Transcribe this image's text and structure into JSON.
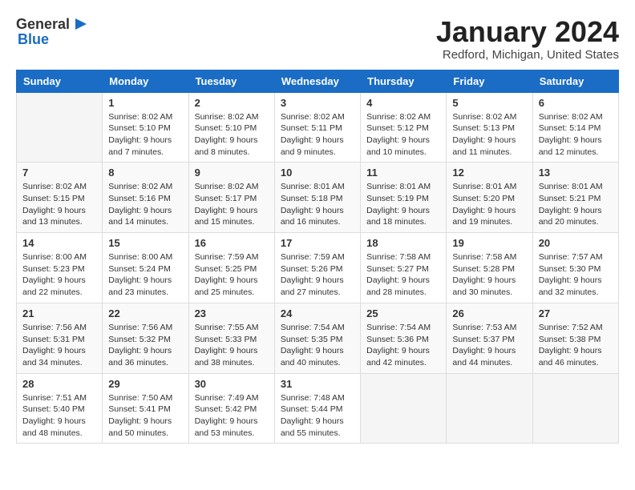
{
  "app": {
    "logo_general": "General",
    "logo_blue": "Blue"
  },
  "header": {
    "month": "January 2024",
    "location": "Redford, Michigan, United States"
  },
  "weekdays": [
    "Sunday",
    "Monday",
    "Tuesday",
    "Wednesday",
    "Thursday",
    "Friday",
    "Saturday"
  ],
  "weeks": [
    [
      {
        "day": "",
        "sunrise": "",
        "sunset": "",
        "daylight": ""
      },
      {
        "day": "1",
        "sunrise": "Sunrise: 8:02 AM",
        "sunset": "Sunset: 5:10 PM",
        "daylight": "Daylight: 9 hours and 7 minutes."
      },
      {
        "day": "2",
        "sunrise": "Sunrise: 8:02 AM",
        "sunset": "Sunset: 5:10 PM",
        "daylight": "Daylight: 9 hours and 8 minutes."
      },
      {
        "day": "3",
        "sunrise": "Sunrise: 8:02 AM",
        "sunset": "Sunset: 5:11 PM",
        "daylight": "Daylight: 9 hours and 9 minutes."
      },
      {
        "day": "4",
        "sunrise": "Sunrise: 8:02 AM",
        "sunset": "Sunset: 5:12 PM",
        "daylight": "Daylight: 9 hours and 10 minutes."
      },
      {
        "day": "5",
        "sunrise": "Sunrise: 8:02 AM",
        "sunset": "Sunset: 5:13 PM",
        "daylight": "Daylight: 9 hours and 11 minutes."
      },
      {
        "day": "6",
        "sunrise": "Sunrise: 8:02 AM",
        "sunset": "Sunset: 5:14 PM",
        "daylight": "Daylight: 9 hours and 12 minutes."
      }
    ],
    [
      {
        "day": "7",
        "sunrise": "Sunrise: 8:02 AM",
        "sunset": "Sunset: 5:15 PM",
        "daylight": "Daylight: 9 hours and 13 minutes."
      },
      {
        "day": "8",
        "sunrise": "Sunrise: 8:02 AM",
        "sunset": "Sunset: 5:16 PM",
        "daylight": "Daylight: 9 hours and 14 minutes."
      },
      {
        "day": "9",
        "sunrise": "Sunrise: 8:02 AM",
        "sunset": "Sunset: 5:17 PM",
        "daylight": "Daylight: 9 hours and 15 minutes."
      },
      {
        "day": "10",
        "sunrise": "Sunrise: 8:01 AM",
        "sunset": "Sunset: 5:18 PM",
        "daylight": "Daylight: 9 hours and 16 minutes."
      },
      {
        "day": "11",
        "sunrise": "Sunrise: 8:01 AM",
        "sunset": "Sunset: 5:19 PM",
        "daylight": "Daylight: 9 hours and 18 minutes."
      },
      {
        "day": "12",
        "sunrise": "Sunrise: 8:01 AM",
        "sunset": "Sunset: 5:20 PM",
        "daylight": "Daylight: 9 hours and 19 minutes."
      },
      {
        "day": "13",
        "sunrise": "Sunrise: 8:01 AM",
        "sunset": "Sunset: 5:21 PM",
        "daylight": "Daylight: 9 hours and 20 minutes."
      }
    ],
    [
      {
        "day": "14",
        "sunrise": "Sunrise: 8:00 AM",
        "sunset": "Sunset: 5:23 PM",
        "daylight": "Daylight: 9 hours and 22 minutes."
      },
      {
        "day": "15",
        "sunrise": "Sunrise: 8:00 AM",
        "sunset": "Sunset: 5:24 PM",
        "daylight": "Daylight: 9 hours and 23 minutes."
      },
      {
        "day": "16",
        "sunrise": "Sunrise: 7:59 AM",
        "sunset": "Sunset: 5:25 PM",
        "daylight": "Daylight: 9 hours and 25 minutes."
      },
      {
        "day": "17",
        "sunrise": "Sunrise: 7:59 AM",
        "sunset": "Sunset: 5:26 PM",
        "daylight": "Daylight: 9 hours and 27 minutes."
      },
      {
        "day": "18",
        "sunrise": "Sunrise: 7:58 AM",
        "sunset": "Sunset: 5:27 PM",
        "daylight": "Daylight: 9 hours and 28 minutes."
      },
      {
        "day": "19",
        "sunrise": "Sunrise: 7:58 AM",
        "sunset": "Sunset: 5:28 PM",
        "daylight": "Daylight: 9 hours and 30 minutes."
      },
      {
        "day": "20",
        "sunrise": "Sunrise: 7:57 AM",
        "sunset": "Sunset: 5:30 PM",
        "daylight": "Daylight: 9 hours and 32 minutes."
      }
    ],
    [
      {
        "day": "21",
        "sunrise": "Sunrise: 7:56 AM",
        "sunset": "Sunset: 5:31 PM",
        "daylight": "Daylight: 9 hours and 34 minutes."
      },
      {
        "day": "22",
        "sunrise": "Sunrise: 7:56 AM",
        "sunset": "Sunset: 5:32 PM",
        "daylight": "Daylight: 9 hours and 36 minutes."
      },
      {
        "day": "23",
        "sunrise": "Sunrise: 7:55 AM",
        "sunset": "Sunset: 5:33 PM",
        "daylight": "Daylight: 9 hours and 38 minutes."
      },
      {
        "day": "24",
        "sunrise": "Sunrise: 7:54 AM",
        "sunset": "Sunset: 5:35 PM",
        "daylight": "Daylight: 9 hours and 40 minutes."
      },
      {
        "day": "25",
        "sunrise": "Sunrise: 7:54 AM",
        "sunset": "Sunset: 5:36 PM",
        "daylight": "Daylight: 9 hours and 42 minutes."
      },
      {
        "day": "26",
        "sunrise": "Sunrise: 7:53 AM",
        "sunset": "Sunset: 5:37 PM",
        "daylight": "Daylight: 9 hours and 44 minutes."
      },
      {
        "day": "27",
        "sunrise": "Sunrise: 7:52 AM",
        "sunset": "Sunset: 5:38 PM",
        "daylight": "Daylight: 9 hours and 46 minutes."
      }
    ],
    [
      {
        "day": "28",
        "sunrise": "Sunrise: 7:51 AM",
        "sunset": "Sunset: 5:40 PM",
        "daylight": "Daylight: 9 hours and 48 minutes."
      },
      {
        "day": "29",
        "sunrise": "Sunrise: 7:50 AM",
        "sunset": "Sunset: 5:41 PM",
        "daylight": "Daylight: 9 hours and 50 minutes."
      },
      {
        "day": "30",
        "sunrise": "Sunrise: 7:49 AM",
        "sunset": "Sunset: 5:42 PM",
        "daylight": "Daylight: 9 hours and 53 minutes."
      },
      {
        "day": "31",
        "sunrise": "Sunrise: 7:48 AM",
        "sunset": "Sunset: 5:44 PM",
        "daylight": "Daylight: 9 hours and 55 minutes."
      },
      {
        "day": "",
        "sunrise": "",
        "sunset": "",
        "daylight": ""
      },
      {
        "day": "",
        "sunrise": "",
        "sunset": "",
        "daylight": ""
      },
      {
        "day": "",
        "sunrise": "",
        "sunset": "",
        "daylight": ""
      }
    ]
  ]
}
